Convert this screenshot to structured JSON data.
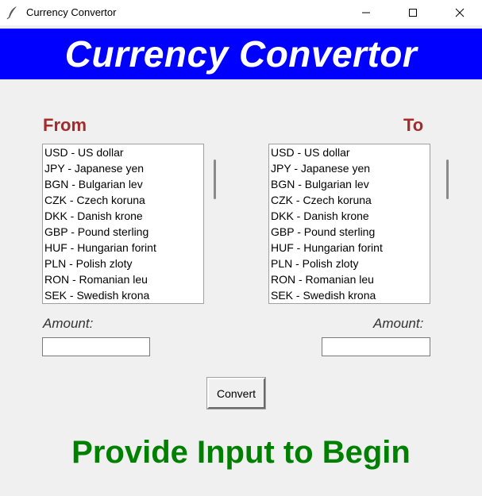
{
  "window": {
    "title": "Currency Convertor",
    "icon": "feather-icon",
    "controls": [
      "minimize-icon",
      "maximize-icon",
      "close-icon"
    ]
  },
  "banner": {
    "title": "Currency Convertor",
    "background": "#0000ff",
    "color": "#ffffff"
  },
  "from": {
    "label": "From",
    "amount_label": "Amount:",
    "amount_value": ""
  },
  "to": {
    "label": "To",
    "amount_label": "Amount:",
    "amount_value": ""
  },
  "currencies": [
    "USD - US dollar",
    "JPY - Japanese yen",
    "BGN - Bulgarian lev",
    "CZK - Czech koruna",
    "DKK - Danish krone",
    "GBP - Pound sterling",
    "HUF - Hungarian forint",
    "PLN - Polish zloty",
    "RON - Romanian leu",
    "SEK - Swedish krona"
  ],
  "convert_button": {
    "label": "Convert"
  },
  "status": {
    "text": "Provide Input to Begin",
    "color": "#008000"
  },
  "colors": {
    "label": "#a52a2a",
    "window_bg": "#f0f0f0"
  }
}
